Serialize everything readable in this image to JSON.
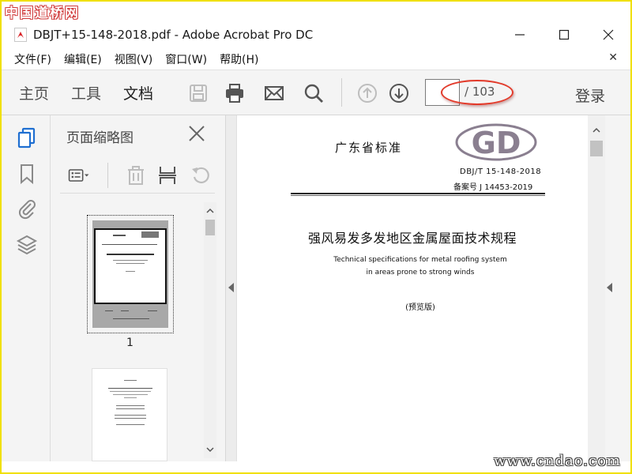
{
  "watermark": {
    "top": "中国道桥网",
    "bottom": "www.cndao.com"
  },
  "window": {
    "title": "DBJT+15-148-2018.pdf - Adobe Acrobat Pro DC"
  },
  "menu": {
    "items": [
      "文件(F)",
      "编辑(E)",
      "视图(V)",
      "窗口(W)",
      "帮助(H)"
    ]
  },
  "toolbar": {
    "tabs": [
      "主页",
      "工具",
      "文档"
    ],
    "active_tab": "文档",
    "page_current": "",
    "page_total": "/ 103",
    "login_label": "登录"
  },
  "thumbnails_panel": {
    "title": "页面缩略图",
    "page_label": "1"
  },
  "document": {
    "header": "广东省标准",
    "logo_text": "GD",
    "standard_no": "DBJ/T 15-148-2018",
    "record_no": "备案号  J 14453-2019",
    "title_cn": "强风易发多发地区金属屋面技术规程",
    "title_en_line1": "Technical specifications for metal roofing system",
    "title_en_line2": "in areas prone to strong winds",
    "preview_label": "(预览版)"
  },
  "colors": {
    "frame_border": "#f0e000",
    "highlight_ellipse": "#e23a2a",
    "rail_active_icon": "#1f6fd1",
    "toolbar_bg": "#f4f4f4"
  }
}
